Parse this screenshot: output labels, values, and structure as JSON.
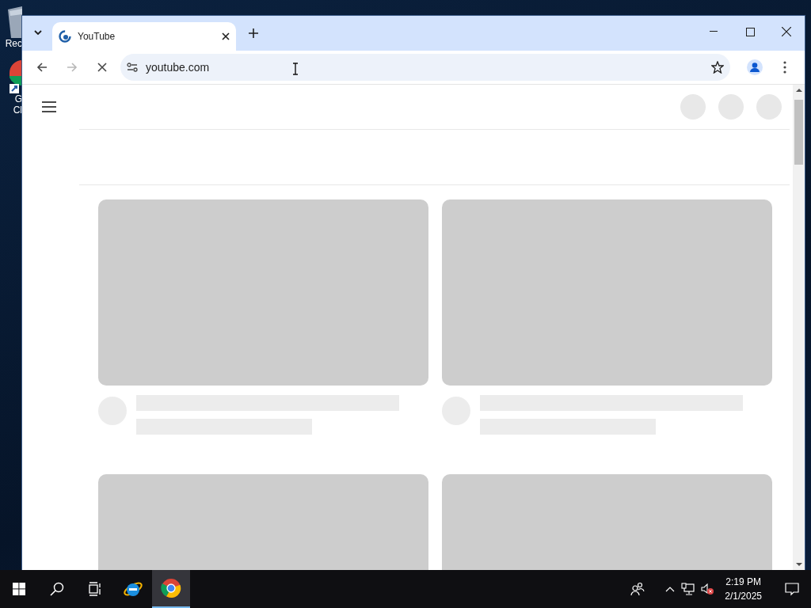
{
  "desktop": {
    "icons": [
      {
        "kind": "bin",
        "lines": [
          "Rec"
        ]
      },
      {
        "kind": "chrome",
        "lines": [
          "G",
          "Cl"
        ]
      }
    ]
  },
  "browser": {
    "tabs": [
      {
        "title": "YouTube",
        "selected": true
      }
    ],
    "forward_disabled": true,
    "loading": true,
    "address": "youtube.com",
    "feed": {
      "cards": [
        {
          "kind": "skeleton"
        },
        {
          "kind": "skeleton"
        },
        {
          "kind": "thumbnail_only"
        },
        {
          "kind": "thumbnail_only"
        }
      ]
    }
  },
  "taskbar": {
    "apps": [
      {
        "kind": "ie",
        "selected": false
      },
      {
        "kind": "chrome",
        "selected": true
      }
    ],
    "time": "2:19 PM",
    "date": "2/1/2025"
  }
}
